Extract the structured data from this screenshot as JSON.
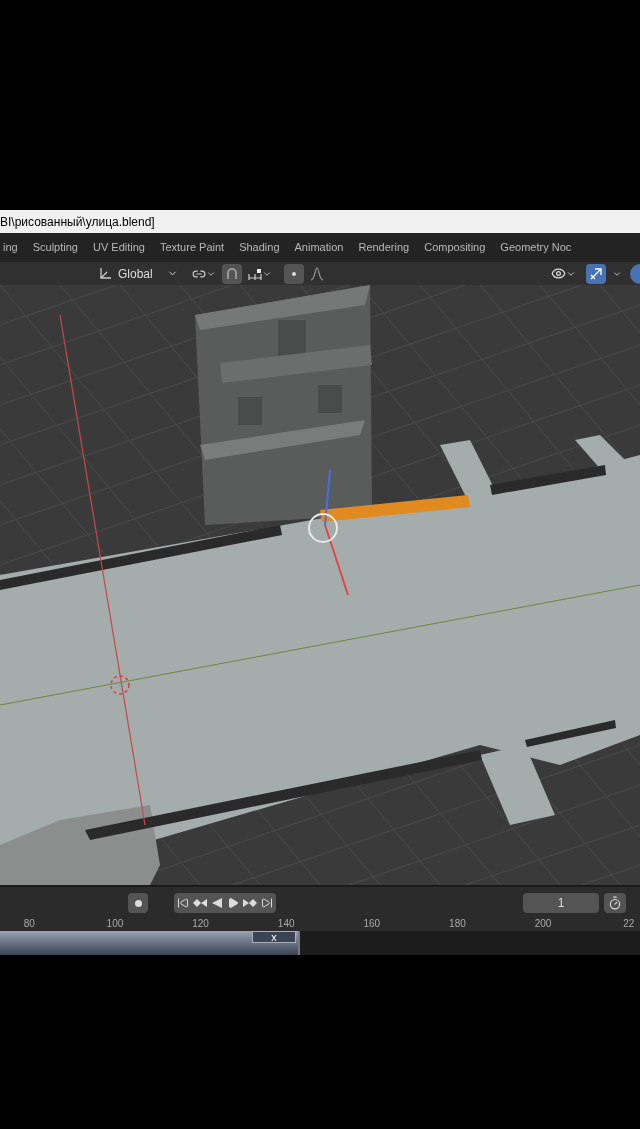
{
  "window": {
    "title": "BI\\рисованный\\улица.blend]"
  },
  "workspace_tabs": [
    {
      "label": "ing",
      "selected": false
    },
    {
      "label": "Sculpting",
      "selected": false
    },
    {
      "label": "UV Editing",
      "selected": false
    },
    {
      "label": "Texture Paint",
      "selected": false
    },
    {
      "label": "Shading",
      "selected": false
    },
    {
      "label": "Animation",
      "selected": false
    },
    {
      "label": "Rendering",
      "selected": false
    },
    {
      "label": "Compositing",
      "selected": false
    },
    {
      "label": "Geometry Noc",
      "selected": false
    }
  ],
  "viewport_header": {
    "orientation": "Global",
    "snap_on": false,
    "proportional_on": false,
    "gizmo_on": true
  },
  "timeline": {
    "current_frame": "1",
    "ruler": [
      "80",
      "100",
      "120",
      "140",
      "160",
      "180",
      "200",
      "22"
    ],
    "close_label": "x"
  }
}
